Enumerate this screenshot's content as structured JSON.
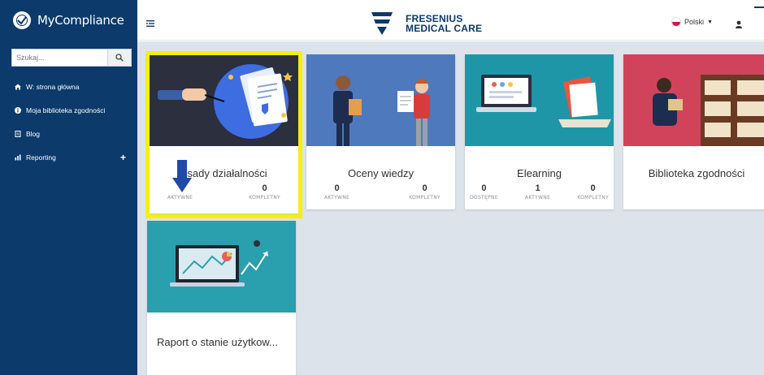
{
  "app": {
    "name": "MyCompliance"
  },
  "search": {
    "placeholder": "Szukaj..."
  },
  "sidebar": {
    "items": [
      {
        "label": "W: strona główna",
        "icon": "home-icon"
      },
      {
        "label": "Moja biblioteka zgodności",
        "icon": "info-icon"
      },
      {
        "label": "Blog",
        "icon": "document-icon"
      },
      {
        "label": "Reporting",
        "icon": "bar-chart-icon"
      }
    ]
  },
  "header": {
    "logo_line1": "FRESENIUS",
    "logo_line2": "MEDICAL CARE",
    "language": "Polski"
  },
  "cards": [
    {
      "title": "Zasady działalności",
      "visible_title": "sady działalności",
      "stats": [
        {
          "value": "",
          "label": "AKTYWNE"
        },
        {
          "value": "0",
          "label": "KOMPLETNY"
        }
      ]
    },
    {
      "title": "Oceny wiedzy",
      "stats": [
        {
          "value": "0",
          "label": "AKTYWNE"
        },
        {
          "value": "0",
          "label": "KOMPLETNY"
        }
      ]
    },
    {
      "title": "Elearning",
      "stats": [
        {
          "value": "0",
          "label": "DOSTĘPNE"
        },
        {
          "value": "1",
          "label": "AKTYWNE"
        },
        {
          "value": "0",
          "label": "KOMPLETNY"
        }
      ]
    },
    {
      "title": "Biblioteka zgodności",
      "stats": []
    },
    {
      "title": "Raport o stanie użytkow...",
      "stats": []
    }
  ],
  "colors": {
    "sidebar": "#0b3a6b",
    "highlight": "#f5ef0a",
    "content_bg": "#dde3ea",
    "card1_bg": "#2b2f3e",
    "card2_bg": "#4e79bd",
    "card3_bg": "#1f96a8",
    "card4_bg": "#d1435b",
    "card5_bg": "#2a9fae"
  }
}
